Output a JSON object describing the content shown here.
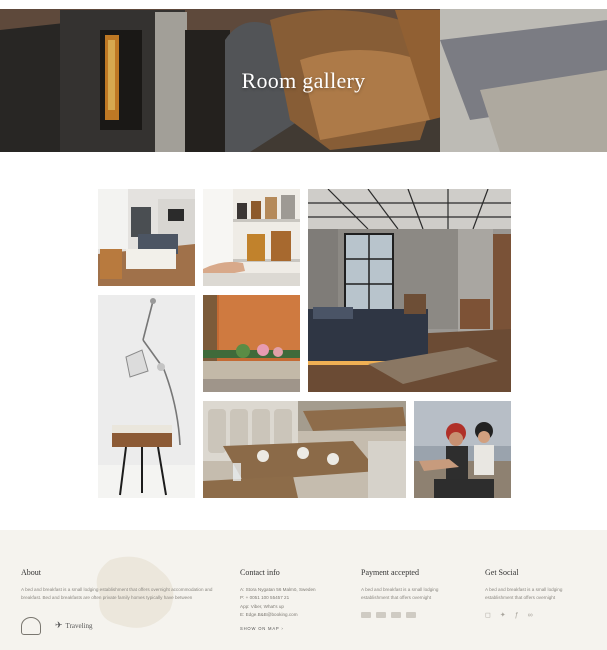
{
  "hero": {
    "title": "Room gallery"
  },
  "gallery": {
    "images": [
      "living-loft",
      "kitchen-shelf",
      "loft-bedroom",
      "wall-lamp",
      "orange-wall-patio",
      "restaurant-tables",
      "couple-scooter"
    ]
  },
  "footer": {
    "about": {
      "heading": "About",
      "text": "A bed and breakfast is a small lodging establishment that offers overnight accommodation and breakfast. Bed and breakfasts are often private family homes typically have between",
      "logo_text": "Traveling"
    },
    "contact": {
      "heading": "Contact info",
      "address": "A: Stora Nygatan 56 Malmö, Sweden",
      "phone": "P: + 0051 100 55457 21",
      "app": "App: Viber, What's up",
      "email": "E: Edge.B&B@booking.com",
      "map_link": "SHOW ON MAP  ›"
    },
    "payment": {
      "heading": "Payment accepted",
      "text": "A bed and breakfast is a small lodging establishment that offers overnight",
      "icons": [
        "paypal-icon",
        "visa-icon",
        "mastercard-icon",
        "amex-icon"
      ]
    },
    "social": {
      "heading": "Get Social",
      "text": "A bed and breakfast is a small lodging establishment that offers overnight",
      "icons": [
        "instagram-icon",
        "twitter-icon",
        "facebook-icon",
        "tripadvisor-icon"
      ]
    }
  }
}
